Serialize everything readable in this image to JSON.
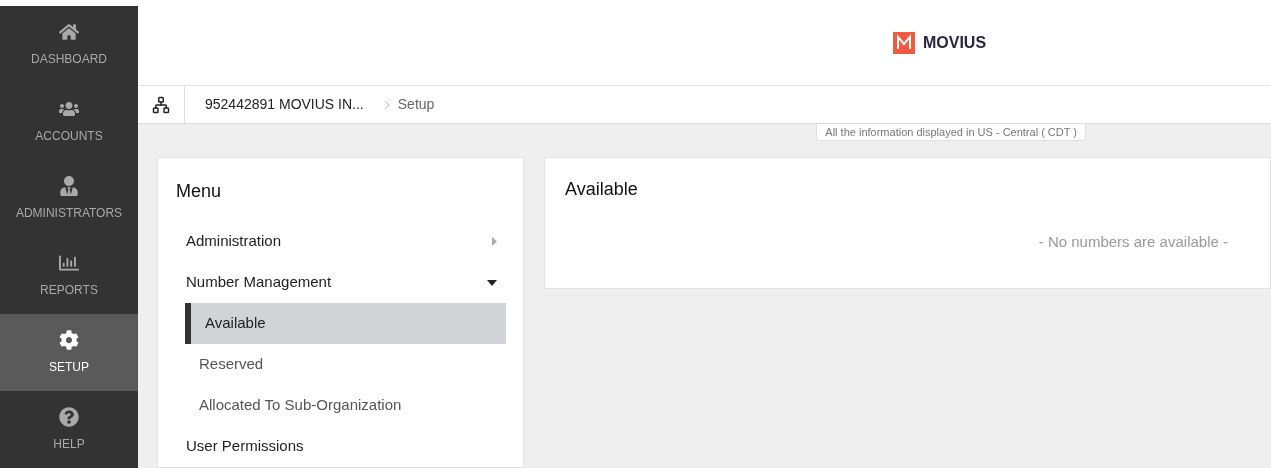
{
  "sidebar": {
    "items": [
      {
        "label": "DASHBOARD",
        "selected": false
      },
      {
        "label": "ACCOUNTS",
        "selected": false
      },
      {
        "label": "ADMINISTRATORS",
        "selected": false
      },
      {
        "label": "REPORTS",
        "selected": false
      },
      {
        "label": "SETUP",
        "selected": true
      },
      {
        "label": "HELP",
        "selected": false
      }
    ]
  },
  "header": {
    "logo": "MOVIUS"
  },
  "breadcrumb": [
    "952442891 MOVIUS IN...",
    "Setup"
  ],
  "timezone_note": "All the information displayed in US - Central ( CDT )",
  "menu": {
    "title": "Menu",
    "items": [
      {
        "label": "Administration",
        "expanded": false
      },
      {
        "label": "Number Management",
        "expanded": true,
        "children": [
          {
            "label": "Available",
            "selected": true
          },
          {
            "label": "Reserved",
            "selected": false
          },
          {
            "label": "Allocated To Sub-Organization",
            "selected": false
          }
        ]
      },
      {
        "label": "User Permissions"
      }
    ]
  },
  "content": {
    "title": "Available",
    "empty_message": "- No numbers are available -"
  }
}
